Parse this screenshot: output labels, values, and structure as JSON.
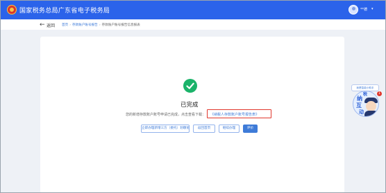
{
  "header": {
    "title": "国家税务总局广东省电子税务局",
    "user_name": "**德",
    "user_caret": "▾"
  },
  "breadcrumb": {
    "back_arrow": "←",
    "back_label": "返回",
    "items": [
      "首页",
      "存款账户账号报告",
      "存款账户账号报告信息报表"
    ],
    "separator": "›"
  },
  "result": {
    "title": "已完成",
    "message": "您的新增存款账户账号申请已完成，点击查看下载：",
    "report_link": "《纳税人存款账户账号报告表》"
  },
  "buttons": {
    "sign_agreement": "立即办理新增三方（委托）划缴协议",
    "back_home": "返回首页",
    "continue": "继续办理",
    "evaluate": "评价"
  },
  "assistant": {
    "tip": "我是智能小助手",
    "badge": "1",
    "chars": [
      "纳",
      "税",
      "互",
      "动"
    ]
  },
  "colors": {
    "header_bg": "#2b63ea",
    "success": "#1bb36a",
    "link": "#3e7bd8",
    "highlight_border": "#e0362c"
  }
}
